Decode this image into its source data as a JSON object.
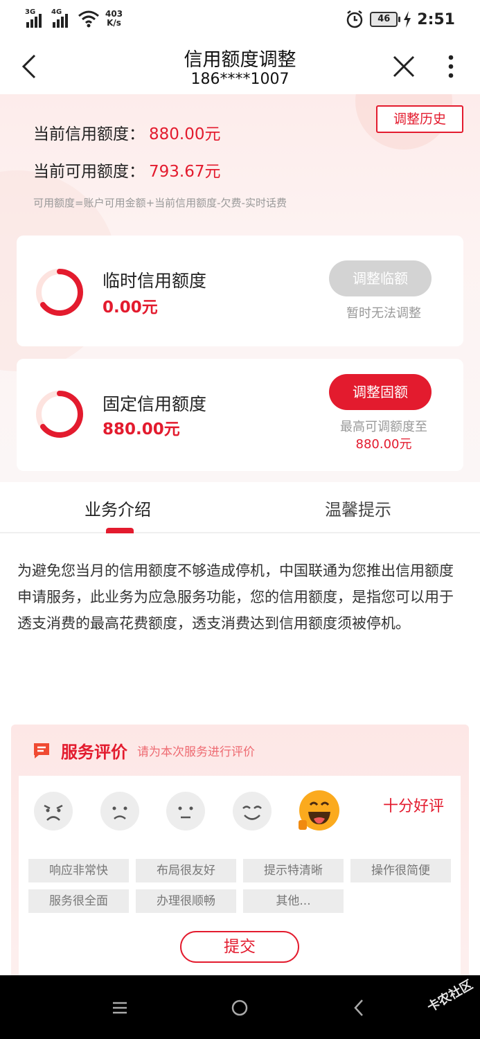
{
  "status_bar": {
    "sim1": "3G",
    "sim2": "4G",
    "net_speed_value": "403",
    "net_speed_unit": "K/s",
    "battery": "46",
    "time": "2:51"
  },
  "header": {
    "title": "信用额度调整",
    "subtitle": "186****1007"
  },
  "summary": {
    "history_button": "调整历史",
    "current_credit_label": "当前信用额度：",
    "current_credit_value": "880.00元",
    "available_label": "当前可用额度：",
    "available_value": "793.67元",
    "formula": "可用额度=账户可用金额+当前信用额度-欠费-实时话费"
  },
  "temp_card": {
    "title": "临时信用额度",
    "value": "0.00元",
    "button": "调整临额",
    "note": "暂时无法调整"
  },
  "fixed_card": {
    "title": "固定信用额度",
    "value": "880.00元",
    "button": "调整固额",
    "note": "最高可调额度至",
    "note_value": "880.00元"
  },
  "tabs": [
    {
      "label": "业务介绍"
    },
    {
      "label": "温馨提示"
    }
  ],
  "intro_text": "为避免您当月的信用额度不够造成停机，中国联通为您推出信用额度申请服务，此业务为应急服务功能，您的信用额度，是指您可以用于透支消费的最高花费额度，透支消费达到信用额度须被停机。",
  "evaluation": {
    "title": "服务评价",
    "subtitle": "请为本次服务进行评价",
    "rating_text": "十分好评",
    "tags": [
      "响应非常快",
      "布局很友好",
      "提示特清晰",
      "操作很简便",
      "服务很全面",
      "办理很顺畅",
      "其他..."
    ],
    "submit": "提交"
  },
  "watermark": "卡农社区",
  "colors": {
    "accent": "#e31b2e",
    "disabled": "#d3d3d3",
    "nav_bg": "#000000"
  }
}
